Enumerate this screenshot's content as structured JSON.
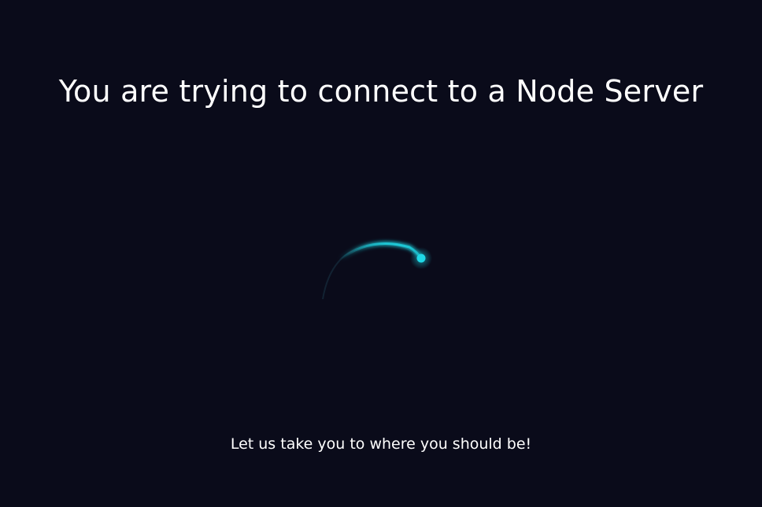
{
  "page": {
    "title": "You are trying to connect to a Node Server",
    "subtitle": "Let us take you to where you should be!"
  },
  "spinner": {
    "icon": "loading-spinner-icon",
    "accent_color": "#1fd8e6"
  },
  "colors": {
    "background": "#0a0b1a",
    "text": "#ffffff"
  }
}
